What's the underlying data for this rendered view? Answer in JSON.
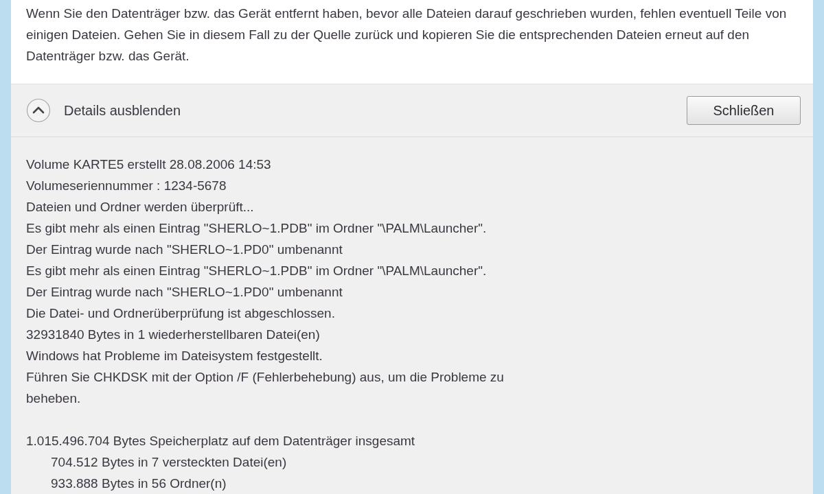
{
  "message": "Wenn Sie den Datenträger bzw. das Gerät entfernt haben, bevor alle Dateien darauf geschrieben wurden, fehlen eventuell Teile von einigen Dateien. Gehen Sie in diesem Fall zu der Quelle zurück und kopieren Sie die entsprechenden Dateien erneut auf den Datenträger bzw. das Gerät.",
  "details_toggle": {
    "label": "Details ausblenden",
    "expanded": true
  },
  "close_button": "Schließen",
  "log_blocks": [
    [
      {
        "text": "Volume KARTE5 erstellt 28.08.2006 14:53",
        "kind": "plain"
      },
      {
        "text": "Volumeseriennummer : 1234-5678",
        "kind": "plain"
      },
      {
        "text": "Dateien und Ordner werden überprüft...",
        "kind": "plain"
      },
      {
        "text": "Es gibt mehr als einen Eintrag \"SHERLO~1.PDB\" im Ordner \"\\PALM\\Launcher\".",
        "kind": "plain"
      },
      {
        "text": "Der Eintrag wurde nach \"SHERLO~1.PD0\" umbenannt",
        "kind": "plain"
      },
      {
        "text": "Es gibt mehr als einen Eintrag \"SHERLO~1.PDB\" im Ordner \"\\PALM\\Launcher\".",
        "kind": "plain"
      },
      {
        "text": "Der Eintrag wurde nach \"SHERLO~1.PD0\" umbenannt",
        "kind": "plain"
      },
      {
        "text": "Die Datei- und Ordnerüberprüfung ist abgeschlossen.",
        "kind": "plain"
      },
      {
        "text": "32931840 Bytes in 1 wiederherstellbaren Datei(en)",
        "kind": "plain"
      },
      {
        "text": "Windows hat Probleme im Dateisystem festgestellt.",
        "kind": "plain"
      },
      {
        "text": "Führen Sie CHKDSK mit der Option /F (Fehlerbehebung) aus, um die Probleme zu",
        "kind": "plain"
      },
      {
        "text": "beheben.",
        "kind": "plain"
      }
    ],
    [
      {
        "text": "1.015.496.704 Bytes Speicherplatz auf dem Datenträger insgesamt",
        "kind": "plain"
      },
      {
        "text": "704.512 Bytes in 7 versteckten Datei(en)",
        "kind": "indented"
      },
      {
        "text": "933.888 Bytes in 56 Ordner(n)",
        "kind": "indented"
      }
    ]
  ]
}
